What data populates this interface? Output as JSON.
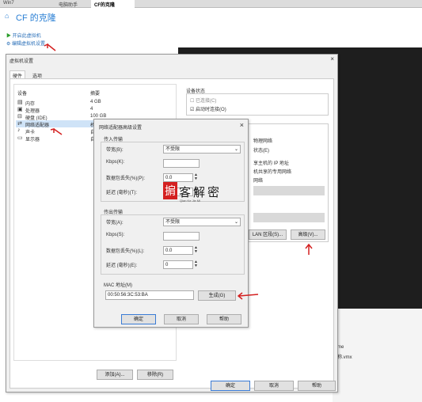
{
  "tabs": [
    "Win7",
    "电脑助手",
    "CF的克隆"
  ],
  "vm": {
    "title": "CF 的克隆",
    "start_action": "开启此虚拟机",
    "edit_action": "编辑虚拟机设置"
  },
  "settings": {
    "title": "虚拟机设置",
    "tabs": [
      "硬件",
      "选项"
    ],
    "col_device": "设备",
    "col_summary": "摘要",
    "devices": [
      {
        "name": "内存",
        "summary": "4 GB",
        "icon": "memory-icon"
      },
      {
        "name": "处理器",
        "summary": "4",
        "icon": "cpu-icon"
      },
      {
        "name": "硬盘 (IDE)",
        "summary": "100 GB",
        "icon": "disk-icon"
      },
      {
        "name": "网络适配器",
        "summary": "桥",
        "icon": "network-icon"
      },
      {
        "name": "声卡",
        "summary": "自",
        "icon": "sound-icon"
      },
      {
        "name": "显示器",
        "summary": "自",
        "icon": "display-icon"
      }
    ],
    "device_status": {
      "label": "设备状态",
      "connected": "已连接(C)",
      "connect_on_power": "启动时连接(O)"
    },
    "right_fragments": [
      "物理网络",
      "状态(E)",
      "享主机的 IP 地址",
      "机共享的专用网络",
      "网络"
    ],
    "lan_button": "LAN 区段(S)...",
    "advanced_button": "高级(V)...",
    "add_button": "添加(A)...",
    "remove_button": "移除(R)",
    "ok": "确定",
    "cancel": "取消",
    "help": "帮助"
  },
  "adv": {
    "title": "网络适配器高级设置",
    "incoming": {
      "label": "传入传输",
      "bandwidth_label": "带宽(B):",
      "bandwidth_value": "不受限",
      "kbps_label": "Kbps(K):",
      "loss_label": "数据包丢失(%)(P):",
      "loss_value": "0.0",
      "latency_label": "延迟 (毫秒)(T):",
      "latency_value": "0"
    },
    "outgoing": {
      "label": "传出传输",
      "bandwidth_label": "带宽(A):",
      "bandwidth_value": "不受限",
      "kbps_label": "Kbps(S):",
      "loss_label": "数据包丢失(%)(L):",
      "loss_value": "0.0",
      "latency_label": "延迟 (毫秒)(E):",
      "latency_value": "0"
    },
    "mac_label": "MAC 地址(M)",
    "mac_value": "00:50:56:3C:53:BA",
    "generate_button": "生成(G)",
    "ok": "确定",
    "cancel": "取消",
    "help": "帮助"
  },
  "watermark": {
    "logo_char": "掮",
    "text": "客解密",
    "pinyin": "Qian Ke Jie Mi"
  },
  "bottom_fragments": [
    "me",
    "称.vmx"
  ],
  "colors": {
    "accent": "#2a7fd4",
    "highlight_arrow": "#d42020",
    "vm_screen": "#1e1e1e",
    "watermark": "#d42020"
  }
}
